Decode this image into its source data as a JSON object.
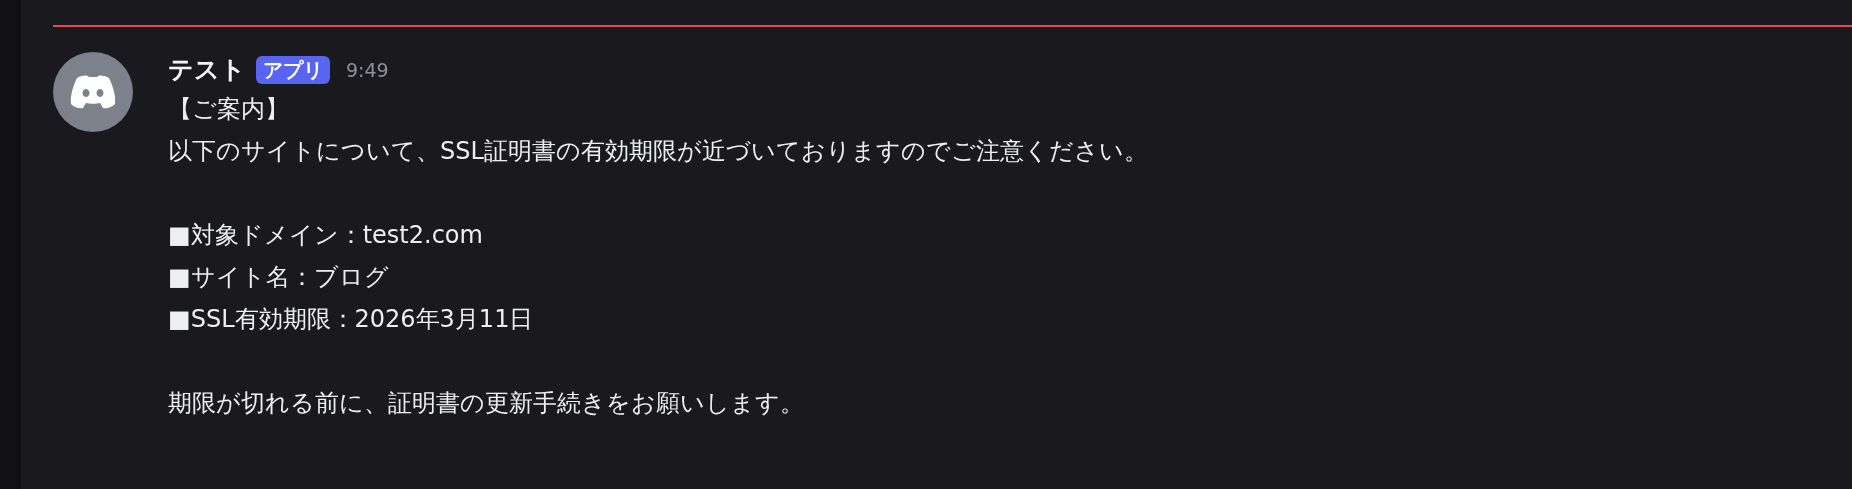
{
  "message": {
    "author": "テスト",
    "badge": "アプリ",
    "time": "9:49",
    "paragraphs": [
      [
        "【ご案内】",
        "以下のサイトについて、SSL証明書の有効期限が近づいておりますのでご注意ください。"
      ],
      [
        "■対象ドメイン：test2.com",
        "■サイト名：ブログ",
        "■SSL有効期限：2026年3月11日"
      ],
      [
        "期限が切れる前に、証明書の更新手続きをお願いします。"
      ]
    ]
  }
}
